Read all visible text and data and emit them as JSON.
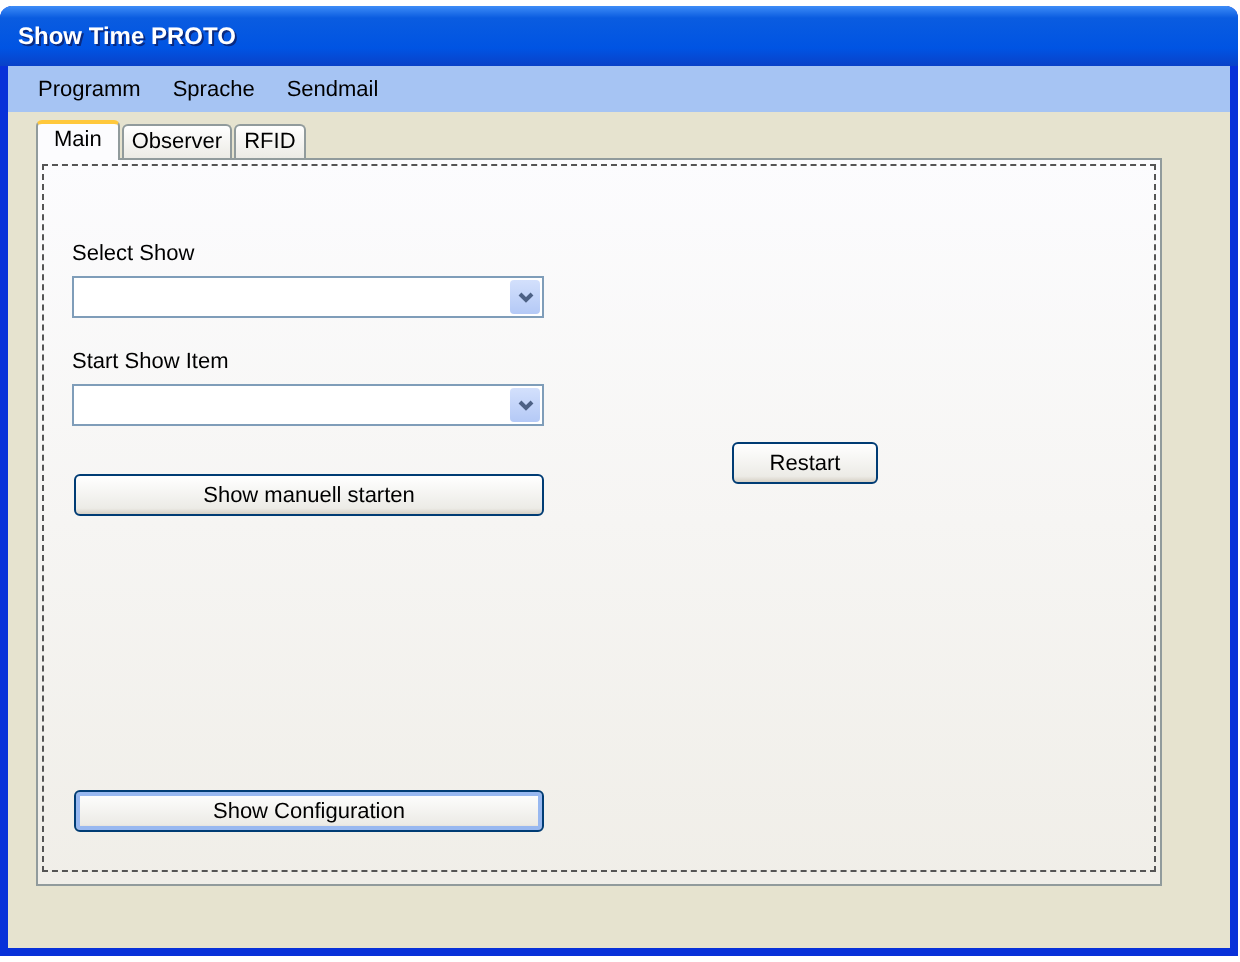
{
  "window": {
    "title": "Show Time PROTO"
  },
  "menu": [
    {
      "label": "Programm"
    },
    {
      "label": "Sprache"
    },
    {
      "label": "Sendmail"
    }
  ],
  "tabs": [
    {
      "label": "Main",
      "selected": true
    },
    {
      "label": "Observer",
      "selected": false
    },
    {
      "label": "RFID",
      "selected": false
    }
  ],
  "main": {
    "fields": [
      {
        "label": "Select Show"
      },
      {
        "label": "Start Show Item"
      }
    ],
    "start_button": "Show manuell starten",
    "restart_button": "Restart",
    "config_button": {
      "label": "Show Configuration",
      "focused": true
    }
  }
}
